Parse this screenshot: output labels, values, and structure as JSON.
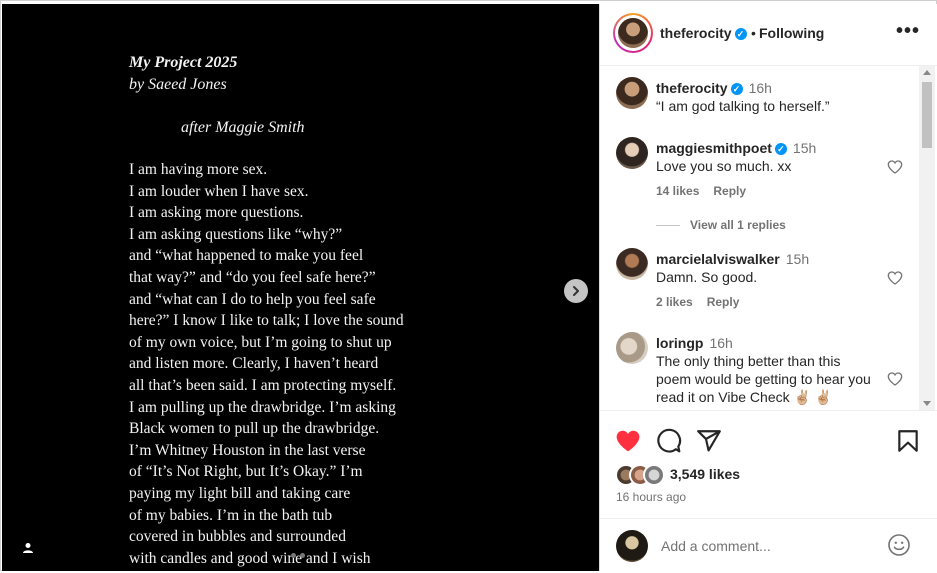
{
  "post": {
    "poem_title": "My Project 2025",
    "poem_author": "by Saeed Jones",
    "poem_dedication": "after Maggie Smith",
    "poem_lines": [
      "I am having more sex.",
      "I am louder when I have sex.",
      "I am asking more questions.",
      "I am asking questions like “why?”",
      "and “what happened to make you feel",
      "that way?” and “do you feel safe here?”",
      "and “what can I do to help you feel safe",
      "here?” I know I like to talk; I love the sound",
      "of my own voice, but I’m going to shut up",
      "and listen more. Clearly, I haven’t heard",
      "all that’s been said. I am protecting myself.",
      "I am pulling up the drawbridge. I’m asking",
      "Black women to pull up the drawbridge.",
      "I’m Whitney Houston in the last verse",
      "of “It’s Not Right, but It’s Okay.” I’m",
      "paying my light bill and taking care",
      "of my babies. I’m in the bath tub",
      "covered in bubbles and surrounded",
      "with candles and good wine and I wish"
    ]
  },
  "header": {
    "username": "theferocity",
    "separator": "•",
    "follow_status": "Following",
    "more_icon": "more-horizontal-icon"
  },
  "comments": [
    {
      "username": "theferocity",
      "time": "16h",
      "text": "“I am god talking to herself.”"
    },
    {
      "username": "maggiesmithpoet",
      "time": "15h",
      "text": "Love you so much. xx",
      "likes": "14 likes",
      "reply": "Reply",
      "view_replies": "View all 1 replies"
    },
    {
      "username": "marcielalviswalker",
      "time": "15h",
      "text": "Damn. So good.",
      "likes": "2 likes",
      "reply": "Reply"
    },
    {
      "username": "loringp",
      "time": "16h",
      "text_lines": [
        "The only thing better than this",
        "poem would be getting to hear you",
        "read it on Vibe Check ✌🏼 ✌🏼"
      ]
    }
  ],
  "actions": {
    "likes": "3,549 likes",
    "posted": "16 hours ago",
    "comment_placeholder": "Add a comment...",
    "colors": {
      "liked_heart": "#ff3040",
      "verified": "#0095f6",
      "text": "#262626",
      "muted": "#737373"
    }
  }
}
